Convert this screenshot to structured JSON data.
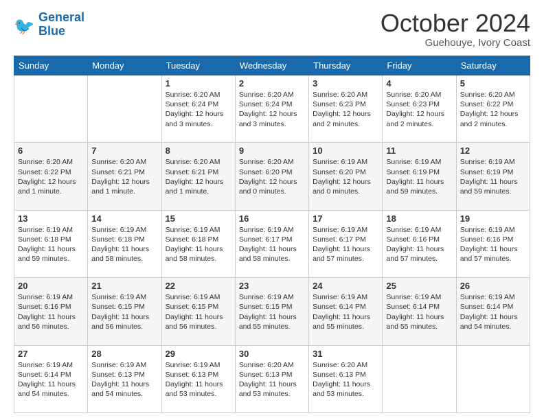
{
  "header": {
    "logo_line1": "General",
    "logo_line2": "Blue",
    "month": "October 2024",
    "location": "Guehouye, Ivory Coast"
  },
  "days_of_week": [
    "Sunday",
    "Monday",
    "Tuesday",
    "Wednesday",
    "Thursday",
    "Friday",
    "Saturday"
  ],
  "weeks": [
    [
      {
        "day": "",
        "content": ""
      },
      {
        "day": "",
        "content": ""
      },
      {
        "day": "1",
        "content": "Sunrise: 6:20 AM\nSunset: 6:24 PM\nDaylight: 12 hours and 3 minutes."
      },
      {
        "day": "2",
        "content": "Sunrise: 6:20 AM\nSunset: 6:24 PM\nDaylight: 12 hours and 3 minutes."
      },
      {
        "day": "3",
        "content": "Sunrise: 6:20 AM\nSunset: 6:23 PM\nDaylight: 12 hours and 2 minutes."
      },
      {
        "day": "4",
        "content": "Sunrise: 6:20 AM\nSunset: 6:23 PM\nDaylight: 12 hours and 2 minutes."
      },
      {
        "day": "5",
        "content": "Sunrise: 6:20 AM\nSunset: 6:22 PM\nDaylight: 12 hours and 2 minutes."
      }
    ],
    [
      {
        "day": "6",
        "content": "Sunrise: 6:20 AM\nSunset: 6:22 PM\nDaylight: 12 hours and 1 minute."
      },
      {
        "day": "7",
        "content": "Sunrise: 6:20 AM\nSunset: 6:21 PM\nDaylight: 12 hours and 1 minute."
      },
      {
        "day": "8",
        "content": "Sunrise: 6:20 AM\nSunset: 6:21 PM\nDaylight: 12 hours and 1 minute."
      },
      {
        "day": "9",
        "content": "Sunrise: 6:20 AM\nSunset: 6:20 PM\nDaylight: 12 hours and 0 minutes."
      },
      {
        "day": "10",
        "content": "Sunrise: 6:19 AM\nSunset: 6:20 PM\nDaylight: 12 hours and 0 minutes."
      },
      {
        "day": "11",
        "content": "Sunrise: 6:19 AM\nSunset: 6:19 PM\nDaylight: 11 hours and 59 minutes."
      },
      {
        "day": "12",
        "content": "Sunrise: 6:19 AM\nSunset: 6:19 PM\nDaylight: 11 hours and 59 minutes."
      }
    ],
    [
      {
        "day": "13",
        "content": "Sunrise: 6:19 AM\nSunset: 6:18 PM\nDaylight: 11 hours and 59 minutes."
      },
      {
        "day": "14",
        "content": "Sunrise: 6:19 AM\nSunset: 6:18 PM\nDaylight: 11 hours and 58 minutes."
      },
      {
        "day": "15",
        "content": "Sunrise: 6:19 AM\nSunset: 6:18 PM\nDaylight: 11 hours and 58 minutes."
      },
      {
        "day": "16",
        "content": "Sunrise: 6:19 AM\nSunset: 6:17 PM\nDaylight: 11 hours and 58 minutes."
      },
      {
        "day": "17",
        "content": "Sunrise: 6:19 AM\nSunset: 6:17 PM\nDaylight: 11 hours and 57 minutes."
      },
      {
        "day": "18",
        "content": "Sunrise: 6:19 AM\nSunset: 6:16 PM\nDaylight: 11 hours and 57 minutes."
      },
      {
        "day": "19",
        "content": "Sunrise: 6:19 AM\nSunset: 6:16 PM\nDaylight: 11 hours and 57 minutes."
      }
    ],
    [
      {
        "day": "20",
        "content": "Sunrise: 6:19 AM\nSunset: 6:16 PM\nDaylight: 11 hours and 56 minutes."
      },
      {
        "day": "21",
        "content": "Sunrise: 6:19 AM\nSunset: 6:15 PM\nDaylight: 11 hours and 56 minutes."
      },
      {
        "day": "22",
        "content": "Sunrise: 6:19 AM\nSunset: 6:15 PM\nDaylight: 11 hours and 56 minutes."
      },
      {
        "day": "23",
        "content": "Sunrise: 6:19 AM\nSunset: 6:15 PM\nDaylight: 11 hours and 55 minutes."
      },
      {
        "day": "24",
        "content": "Sunrise: 6:19 AM\nSunset: 6:14 PM\nDaylight: 11 hours and 55 minutes."
      },
      {
        "day": "25",
        "content": "Sunrise: 6:19 AM\nSunset: 6:14 PM\nDaylight: 11 hours and 55 minutes."
      },
      {
        "day": "26",
        "content": "Sunrise: 6:19 AM\nSunset: 6:14 PM\nDaylight: 11 hours and 54 minutes."
      }
    ],
    [
      {
        "day": "27",
        "content": "Sunrise: 6:19 AM\nSunset: 6:14 PM\nDaylight: 11 hours and 54 minutes."
      },
      {
        "day": "28",
        "content": "Sunrise: 6:19 AM\nSunset: 6:13 PM\nDaylight: 11 hours and 54 minutes."
      },
      {
        "day": "29",
        "content": "Sunrise: 6:19 AM\nSunset: 6:13 PM\nDaylight: 11 hours and 53 minutes."
      },
      {
        "day": "30",
        "content": "Sunrise: 6:20 AM\nSunset: 6:13 PM\nDaylight: 11 hours and 53 minutes."
      },
      {
        "day": "31",
        "content": "Sunrise: 6:20 AM\nSunset: 6:13 PM\nDaylight: 11 hours and 53 minutes."
      },
      {
        "day": "",
        "content": ""
      },
      {
        "day": "",
        "content": ""
      }
    ]
  ]
}
